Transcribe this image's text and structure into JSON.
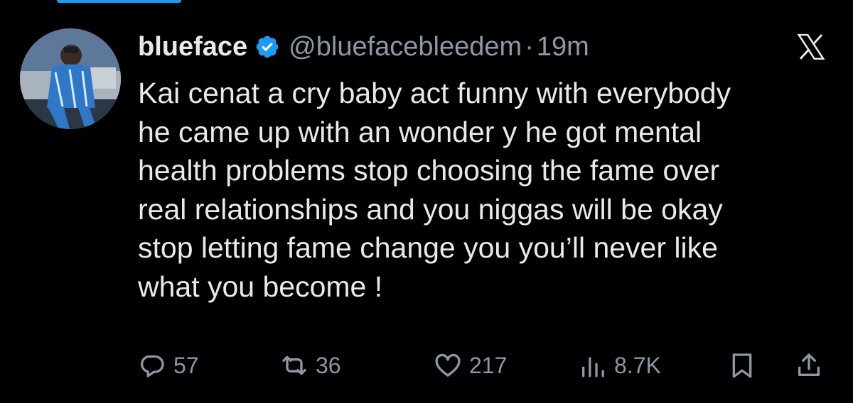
{
  "tweet": {
    "author": {
      "display_name": "blueface",
      "handle": "@bluefacebleedem",
      "verified": true
    },
    "separator": "·",
    "timestamp": "19m",
    "text": "Kai cenat a cry baby act funny with everybody\nhe came up with an wonder y he got mental\nhealth problems stop choosing the fame over\nreal relationships and you niggas will be okay\nstop letting fame change you you’ll never like\nwhat you become !",
    "actions": {
      "replies": "57",
      "reposts": "36",
      "likes": "217",
      "views": "8.7K"
    }
  },
  "icons": {
    "brand": "x-logo-icon",
    "verified": "verified-badge-icon",
    "reply": "reply-icon",
    "repost": "repost-icon",
    "like": "heart-icon",
    "views": "views-icon",
    "bookmark": "bookmark-icon",
    "share": "share-icon"
  },
  "colors": {
    "background": "#000000",
    "text": "#e7e9ea",
    "secondary": "#8b98a5",
    "accent": "#1d9bf0"
  }
}
